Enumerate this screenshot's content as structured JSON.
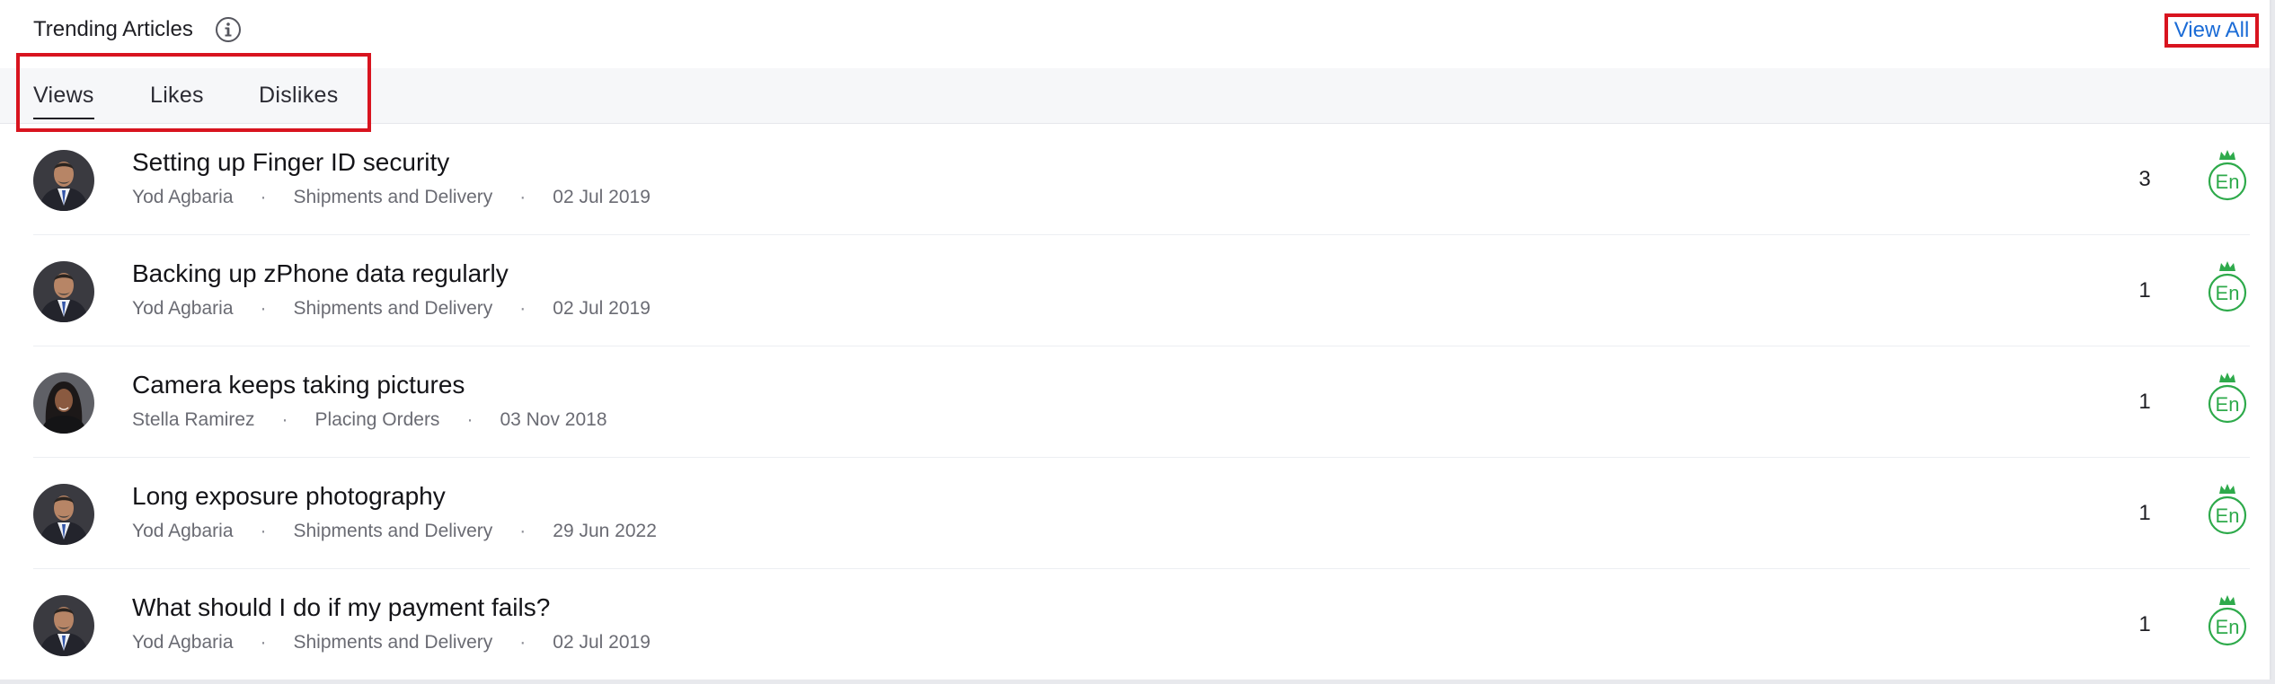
{
  "header": {
    "title": "Trending Articles",
    "view_all": "View All"
  },
  "tabs": [
    {
      "label": "Views",
      "active": true
    },
    {
      "label": "Likes",
      "active": false
    },
    {
      "label": "Dislikes",
      "active": false
    }
  ],
  "colors": {
    "accent_link": "#1a6bd6",
    "highlight_red": "#d8141f",
    "language_badge": "#2eaa4b"
  },
  "articles": [
    {
      "title": "Setting up Finger ID security",
      "author": "Yod Agbaria",
      "category": "Shipments and Delivery",
      "date": "02 Jul 2019",
      "count": "3",
      "lang": "En",
      "avatar": "man-avatar"
    },
    {
      "title": "Backing up zPhone data regularly",
      "author": "Yod Agbaria",
      "category": "Shipments and Delivery",
      "date": "02 Jul 2019",
      "count": "1",
      "lang": "En",
      "avatar": "man-avatar"
    },
    {
      "title": "Camera keeps taking pictures",
      "author": "Stella Ramirez",
      "category": "Placing Orders",
      "date": "03 Nov 2018",
      "count": "1",
      "lang": "En",
      "avatar": "woman-avatar"
    },
    {
      "title": "Long exposure photography",
      "author": "Yod Agbaria",
      "category": "Shipments and Delivery",
      "date": "29 Jun 2022",
      "count": "1",
      "lang": "En",
      "avatar": "man-avatar"
    },
    {
      "title": "What should I do if my payment fails?",
      "author": "Yod Agbaria",
      "category": "Shipments and Delivery",
      "date": "02 Jul 2019",
      "count": "1",
      "lang": "En",
      "avatar": "man-avatar"
    }
  ]
}
